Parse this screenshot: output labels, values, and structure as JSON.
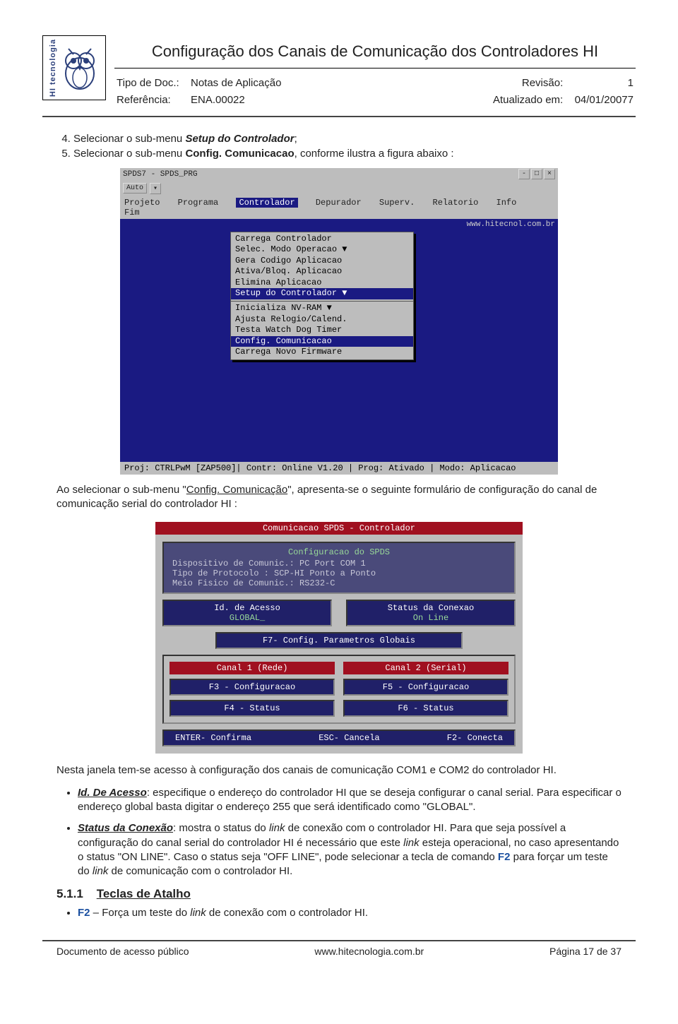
{
  "header": {
    "brand_text": "HI tecnologia",
    "title": "Configuração dos Canais de Comunicação dos Controladores HI",
    "meta_left": {
      "l1_label": "Tipo de Doc.:",
      "l1_value": "Notas de Aplicação",
      "l2_label": "Referência:",
      "l2_value": "ENA.00022"
    },
    "meta_right": {
      "r1_label": "Revisão:",
      "r1_value": "1",
      "r2_label": "Atualizado em:",
      "r2_value": "04/01/20077"
    }
  },
  "body": {
    "list_start": "4",
    "item4_a": "Selecionar o sub-menu ",
    "item4_b": "Setup do Controlador",
    "item4_c": ";",
    "item5_a": "Selecionar o sub-menu ",
    "item5_b": "Config. Comunicacao",
    "item5_c": ", conforme ilustra a figura abaixo :",
    "ss1": {
      "win_title": "SPDS7 - SPDS_PRG",
      "auto": "Auto",
      "menubar": {
        "m1": "Projeto",
        "m2": "Programa",
        "m3": "Controlador",
        "m4": "Depurador",
        "m5": "Superv.",
        "m6": "Relatorio",
        "m7": "Info",
        "m8": "Fim"
      },
      "url": "www.hitecnol.com.br",
      "dropdown": {
        "d1": "Carrega Controlador",
        "d2": "Selec. Modo Operacao   ▼",
        "d3": "Gera Codigo Aplicacao",
        "d4": "Ativa/Bloq. Aplicacao",
        "d5": "Elimina Aplicacao",
        "d6": "Setup do Controlador   ▼",
        "d7": "Inicializa  NV-RAM     ▼",
        "d8": "Ajusta Relogio/Calend.",
        "d9": "Testa Watch Dog Timer",
        "d10": "Config. Comunicacao",
        "d11": "Carrega Novo Firmware"
      },
      "status": "Proj: CTRLPwM [ZAP500]|  Contr: Online V1.20   | Prog: Ativado  | Modo: Aplicacao"
    },
    "mid_para_a": "Ao selecionar o sub-menu \"",
    "mid_para_b": "Config. Comunicação",
    "mid_para_c": "\", apresenta-se o seguinte formulário de configuração do canal de comunicação serial do controlador HI :",
    "ss2": {
      "title": "Comunicacao SPDS - Controlador",
      "cfg": "Configuracao  do  SPDS",
      "l1": "Dispositivo de Comunic.: PC Port COM 1",
      "l2": "    Tipo de Protocolo : SCP-HI Ponto a Ponto",
      "l3": "Meio Fisico de Comunic.: RS232-C",
      "b_id_title": "Id. de Acesso",
      "b_id_val": "GLOBAL_",
      "b_stat_title": "Status da Conexao",
      "b_stat_val": "On Line",
      "f7": "F7- Config. Parametros Globais",
      "c1": "Canal 1 (Rede)",
      "c1a": "F3 - Configuracao",
      "c1b": "F4 -   Status",
      "c2": "Canal 2 (Serial)",
      "c2a": "F5 - Configuracao",
      "c2b": "F6 -   Status",
      "fbar1": "ENTER- Confirma",
      "fbar2": "ESC- Cancela",
      "fbar3": "F2- Conecta"
    },
    "para2": "Nesta janela tem-se acesso à configuração dos canais de comunicação COM1 e COM2 do controlador HI.",
    "bullet1_label": "Id. De Acesso",
    "bullet1_text": ": especifique o endereço do controlador HI que se deseja configurar o canal serial. Para especificar o endereço global basta digitar o endereço 255 que será identificado como \"GLOBAL\".",
    "bullet2_label": "Status da Conexão",
    "bullet2_text_a": ": mostra o status do ",
    "bullet2_text_b": " de conexão com o controlador HI. Para que seja possível a configuração do canal serial do controlador HI é necessário que este ",
    "bullet2_text_c": " esteja operacional, no caso apresentando o status \"ON LINE\". Caso o status seja \"OFF LINE\", pode selecionar a tecla de comando ",
    "bullet2_f2": "F2",
    "bullet2_text_d": " para forçar um teste do ",
    "bullet2_text_e": " de comunicação com o controlador HI.",
    "link_word": "link",
    "sub_num": "5.1.1",
    "sub_title": "Teclas de Atalho",
    "sub_bullet_f2": "F2",
    "sub_bullet_text": " – Força um teste do ",
    "sub_bullet_text2": " de conexão com o controlador HI."
  },
  "footer": {
    "left": "Documento de acesso público",
    "center": "www.hitecnologia.com.br",
    "right": "Página 17 de 37"
  }
}
